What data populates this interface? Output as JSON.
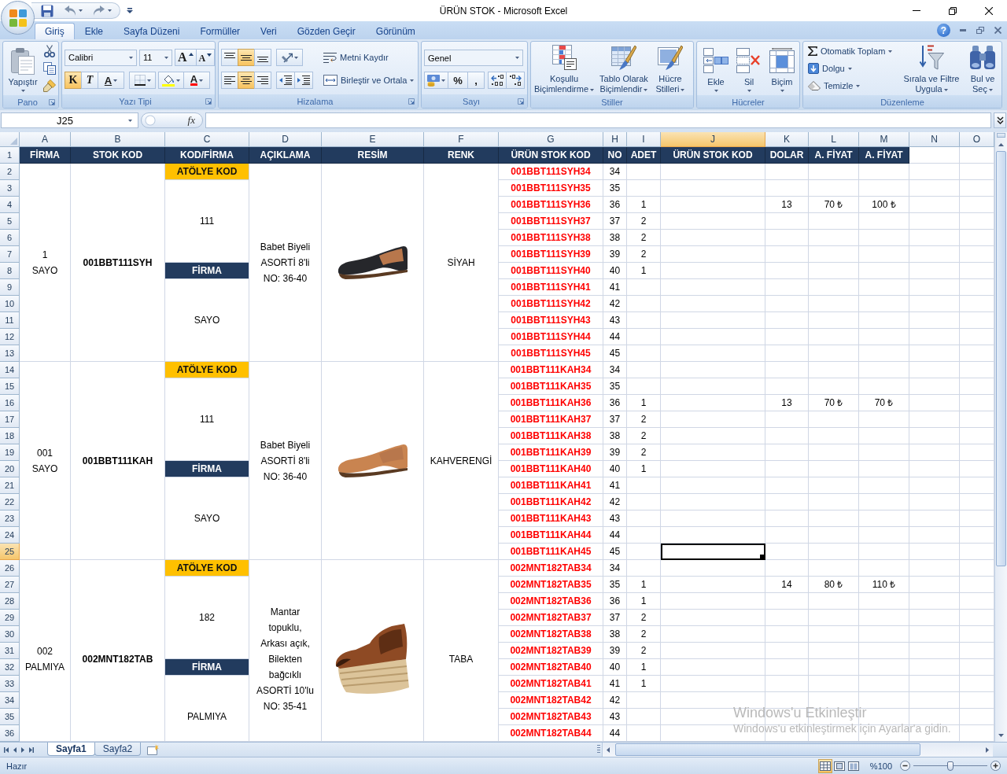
{
  "window": {
    "title": "ÜRÜN STOK - Microsoft Excel"
  },
  "ribbon": {
    "tabs": [
      {
        "label": "Giriş",
        "selected": true
      },
      {
        "label": "Ekle",
        "selected": false
      },
      {
        "label": "Sayfa Düzeni",
        "selected": false
      },
      {
        "label": "Formüller",
        "selected": false
      },
      {
        "label": "Veri",
        "selected": false
      },
      {
        "label": "Gözden Geçir",
        "selected": false
      },
      {
        "label": "Görünüm",
        "selected": false
      }
    ],
    "help": "?",
    "clipboard": {
      "label": "Pano",
      "paste": "Yapıştır"
    },
    "font": {
      "label": "Yazı Tipi",
      "font_name": "Calibri",
      "font_size": "11",
      "grow": "A",
      "shrink": "A",
      "styles": [
        {
          "label": "K",
          "on": true
        },
        {
          "label": "T",
          "on": false
        },
        {
          "label": "A",
          "on": false
        }
      ],
      "font_color": "A"
    },
    "alignment": {
      "label": "Hizalama",
      "vertical": [
        {
          "on": false
        },
        {
          "on": true
        },
        {
          "on": false
        }
      ],
      "horizontal": [
        {
          "on": false
        },
        {
          "on": true
        },
        {
          "on": false
        }
      ],
      "wrap": "Metni Kaydır",
      "merge": "Birleştir ve Ortala"
    },
    "number": {
      "label": "Sayı",
      "format": "Genel",
      "percent": "%",
      "comma": ","
    },
    "styles": {
      "label": "Stiller",
      "buttons": [
        "Koşullu\nBiçimlendirme",
        "Tablo Olarak\nBiçimlendir",
        "Hücre\nStilleri"
      ]
    },
    "cells": {
      "label": "Hücreler",
      "buttons": [
        "Ekle",
        "Sil",
        "Biçim"
      ]
    },
    "editing": {
      "label": "Düzenleme",
      "autosum": "Otomatik Toplam",
      "fill": "Dolgu",
      "clear": "Temizle",
      "sort": "Sırala ve Filtre\nUygula",
      "find": "Bul ve\nSeç"
    }
  },
  "formula_bar": {
    "name_box": "J25",
    "function_button": "fx"
  },
  "sheet": {
    "column_headers": [
      {
        "label": "A",
        "selected": false
      },
      {
        "label": "B",
        "selected": false
      },
      {
        "label": "C",
        "selected": false
      },
      {
        "label": "D",
        "selected": false
      },
      {
        "label": "E",
        "selected": false
      },
      {
        "label": "F",
        "selected": false
      },
      {
        "label": "G",
        "selected": false
      },
      {
        "label": "H",
        "selected": false
      },
      {
        "label": "I",
        "selected": false
      },
      {
        "label": "J",
        "selected": true
      },
      {
        "label": "K",
        "selected": false
      },
      {
        "label": "L",
        "selected": false
      },
      {
        "label": "M",
        "selected": false
      },
      {
        "label": "N",
        "selected": false
      },
      {
        "label": "O",
        "selected": false
      }
    ],
    "row_headers": [
      {
        "label": "1",
        "selected": false
      },
      {
        "label": "2",
        "selected": false
      },
      {
        "label": "3",
        "selected": false
      },
      {
        "label": "4",
        "selected": false
      },
      {
        "label": "5",
        "selected": false
      },
      {
        "label": "6",
        "selected": false
      },
      {
        "label": "7",
        "selected": false
      },
      {
        "label": "8",
        "selected": false
      },
      {
        "label": "9",
        "selected": false
      },
      {
        "label": "10",
        "selected": false
      },
      {
        "label": "11",
        "selected": false
      },
      {
        "label": "12",
        "selected": false
      },
      {
        "label": "13",
        "selected": false
      },
      {
        "label": "14",
        "selected": false
      },
      {
        "label": "15",
        "selected": false
      },
      {
        "label": "16",
        "selected": false
      },
      {
        "label": "17",
        "selected": false
      },
      {
        "label": "18",
        "selected": false
      },
      {
        "label": "19",
        "selected": false
      },
      {
        "label": "20",
        "selected": false
      },
      {
        "label": "21",
        "selected": false
      },
      {
        "label": "22",
        "selected": false
      },
      {
        "label": "23",
        "selected": false
      },
      {
        "label": "24",
        "selected": false
      },
      {
        "label": "25",
        "selected": true
      },
      {
        "label": "26",
        "selected": false
      },
      {
        "label": "27",
        "selected": false
      },
      {
        "label": "28",
        "selected": false
      },
      {
        "label": "29",
        "selected": false
      },
      {
        "label": "30",
        "selected": false
      },
      {
        "label": "31",
        "selected": false
      },
      {
        "label": "32",
        "selected": false
      },
      {
        "label": "33",
        "selected": false
      },
      {
        "label": "34",
        "selected": false
      },
      {
        "label": "35",
        "selected": false
      },
      {
        "label": "36",
        "selected": false
      }
    ],
    "header": [
      "FİRMA",
      "STOK KOD",
      "KOD/FİRMA",
      "AÇIKLAMA",
      "RESİM",
      "RENK",
      "ÜRÜN STOK KOD",
      "NO",
      "ADET",
      "ÜRÜN STOK KOD",
      "DOLAR",
      "A. FİYAT",
      "A. FİYAT"
    ],
    "blocks": [
      {
        "firma": "1\nSAYO",
        "stok_kod": "001BBT111SYH",
        "atolye_label": "ATÖLYE KOD",
        "atolye_kod": "111",
        "firma_label": "FİRMA",
        "firma_adi": "SAYO",
        "aciklama": "Babet Biyeli\nASORTİ 8'li\nNO: 36-40",
        "image": {
          "kind": "flat",
          "color": "#26272b"
        },
        "renk": "SİYAH",
        "rows": [
          {
            "code": "001BBT111SYH34",
            "no": "34"
          },
          {
            "code": "001BBT111SYH35",
            "no": "35"
          },
          {
            "code": "001BBT111SYH36",
            "no": "36",
            "adet": "1",
            "dolar": "13",
            "price_1": "70 ₺",
            "price_2": "100 ₺"
          },
          {
            "code": "001BBT111SYH37",
            "no": "37",
            "adet": "2"
          },
          {
            "code": "001BBT111SYH38",
            "no": "38",
            "adet": "2"
          },
          {
            "code": "001BBT111SYH39",
            "no": "39",
            "adet": "2"
          },
          {
            "code": "001BBT111SYH40",
            "no": "40",
            "adet": "1"
          },
          {
            "code": "001BBT111SYH41",
            "no": "41"
          },
          {
            "code": "001BBT111SYH42",
            "no": "42"
          },
          {
            "code": "001BBT111SYH43",
            "no": "43"
          },
          {
            "code": "001BBT111SYH44",
            "no": "44"
          },
          {
            "code": "001BBT111SYH45",
            "no": "45"
          }
        ]
      },
      {
        "firma": "001\nSAYO",
        "stok_kod": "001BBT111KAH",
        "atolye_label": "ATÖLYE KOD",
        "atolye_kod": "111",
        "firma_label": "FİRMA",
        "firma_adi": "SAYO",
        "aciklama": "Babet Biyeli\nASORTİ 8'li\nNO: 36-40",
        "image": {
          "kind": "flat",
          "color": "#c98450"
        },
        "renk": "KAHVERENGİ",
        "rows": [
          {
            "code": "001BBT111KAH34",
            "no": "34"
          },
          {
            "code": "001BBT111KAH35",
            "no": "35"
          },
          {
            "code": "001BBT111KAH36",
            "no": "36",
            "adet": "1",
            "dolar": "13",
            "price_1": "70 ₺",
            "price_2": "70 ₺"
          },
          {
            "code": "001BBT111KAH37",
            "no": "37",
            "adet": "2"
          },
          {
            "code": "001BBT111KAH38",
            "no": "38",
            "adet": "2"
          },
          {
            "code": "001BBT111KAH39",
            "no": "39",
            "adet": "2"
          },
          {
            "code": "001BBT111KAH40",
            "no": "40",
            "adet": "1"
          },
          {
            "code": "001BBT111KAH41",
            "no": "41"
          },
          {
            "code": "001BBT111KAH42",
            "no": "42"
          },
          {
            "code": "001BBT111KAH43",
            "no": "43"
          },
          {
            "code": "001BBT111KAH44",
            "no": "44"
          },
          {
            "code": "001BBT111KAH45",
            "no": "45"
          }
        ]
      },
      {
        "firma": "002\nPALMIYA",
        "stok_kod": "002MNT182TAB",
        "atolye_label": "ATÖLYE KOD",
        "atolye_kod": "182",
        "firma_label": "FİRMA",
        "firma_adi": "PALMIYA",
        "aciklama": "Mantar\ntopuklu,\nArkası açık,\nBilekten\nbağcıklı\nASORTİ 10'lu\nNO: 35-41",
        "image": {
          "kind": "wedge",
          "color": "#8e4a24"
        },
        "renk": "TABA",
        "rows": [
          {
            "code": "002MNT182TAB34",
            "no": "34"
          },
          {
            "code": "002MNT182TAB35",
            "no": "35",
            "adet": "1",
            "dolar": "14",
            "price_1": "80 ₺",
            "price_2": "110 ₺"
          },
          {
            "code": "002MNT182TAB36",
            "no": "36",
            "adet": "1"
          },
          {
            "code": "002MNT182TAB37",
            "no": "37",
            "adet": "2"
          },
          {
            "code": "002MNT182TAB38",
            "no": "38",
            "adet": "2"
          },
          {
            "code": "002MNT182TAB39",
            "no": "39",
            "adet": "2"
          },
          {
            "code": "002MNT182TAB40",
            "no": "40",
            "adet": "1"
          },
          {
            "code": "002MNT182TAB41",
            "no": "41",
            "adet": "1"
          },
          {
            "code": "002MNT182TAB42",
            "no": "42"
          },
          {
            "code": "002MNT182TAB43",
            "no": "43"
          },
          {
            "code": "002MNT182TAB44",
            "no": "44"
          }
        ]
      }
    ]
  },
  "sheet_tabs": [
    {
      "label": "Sayfa1",
      "selected": true
    },
    {
      "label": "Sayfa2",
      "selected": false
    }
  ],
  "status_bar": {
    "status": "Hazır",
    "views": [
      {
        "selected": true
      },
      {
        "selected": false
      },
      {
        "selected": false
      }
    ],
    "zoom": "%100",
    "zoom_slider": {
      "level": 0.5
    }
  },
  "activation_notice": {
    "title": "Windows'u Etkinleştir",
    "text": "Windows'u etkinleştirmek için Ayarlar'a gidin."
  }
}
